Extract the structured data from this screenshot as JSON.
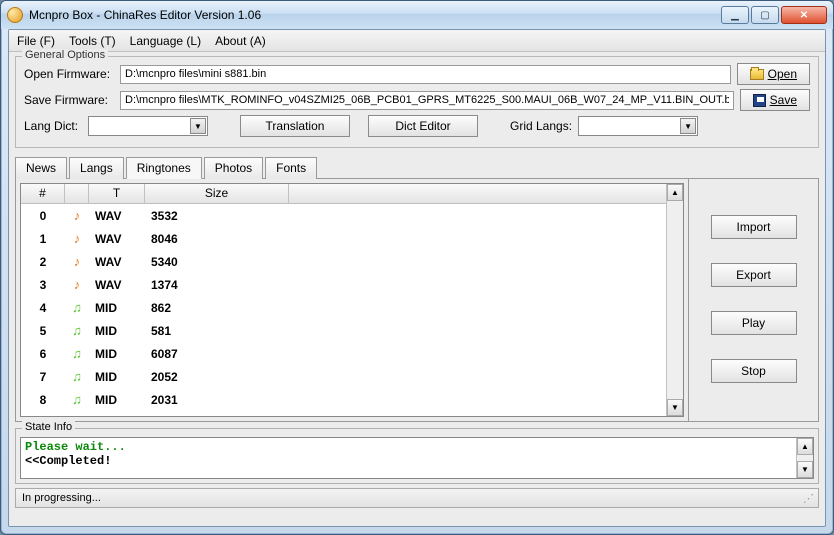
{
  "window": {
    "title": "Mcnpro Box - ChinaRes Editor Version 1.06"
  },
  "menu": {
    "file": "File (F)",
    "tools": "Tools (T)",
    "language": "Language (L)",
    "about": "About (A)"
  },
  "general": {
    "legend": "General Options",
    "open_label": "Open Firmware:",
    "open_path": "D:\\mcnpro files\\mini s881.bin",
    "open_btn": "Open",
    "save_label": "Save Firmware:",
    "save_path": "D:\\mcnpro files\\MTK_ROMINFO_v04SZMI25_06B_PCB01_GPRS_MT6225_S00.MAUI_06B_W07_24_MP_V11.BIN_OUT.bin",
    "save_btn": "Save",
    "langdict_label": "Lang Dict:",
    "langdict_value": "",
    "translation_btn": "Translation",
    "dicteditor_btn": "Dict Editor",
    "gridlangs_label": "Grid Langs:",
    "gridlangs_value": ""
  },
  "tabs": {
    "items": [
      "News",
      "Langs",
      "Ringtones",
      "Photos",
      "Fonts"
    ],
    "active": 2
  },
  "table": {
    "columns": {
      "num": "#",
      "type": "T",
      "size": "Size"
    },
    "rows": [
      {
        "num": "0",
        "kind": "wav",
        "type": "WAV",
        "size": "3532"
      },
      {
        "num": "1",
        "kind": "wav",
        "type": "WAV",
        "size": "8046"
      },
      {
        "num": "2",
        "kind": "wav",
        "type": "WAV",
        "size": "5340"
      },
      {
        "num": "3",
        "kind": "wav",
        "type": "WAV",
        "size": "1374"
      },
      {
        "num": "4",
        "kind": "mid",
        "type": "MID",
        "size": "862"
      },
      {
        "num": "5",
        "kind": "mid",
        "type": "MID",
        "size": "581"
      },
      {
        "num": "6",
        "kind": "mid",
        "type": "MID",
        "size": "6087"
      },
      {
        "num": "7",
        "kind": "mid",
        "type": "MID",
        "size": "2052"
      },
      {
        "num": "8",
        "kind": "mid",
        "type": "MID",
        "size": "2031"
      }
    ]
  },
  "sidebar": {
    "import": "Import",
    "export": "Export",
    "play": "Play",
    "stop": "Stop"
  },
  "stateinfo": {
    "legend": "State Info",
    "line1": "Please wait...",
    "line2": "<<Completed!"
  },
  "status": {
    "text": "In progressing..."
  }
}
